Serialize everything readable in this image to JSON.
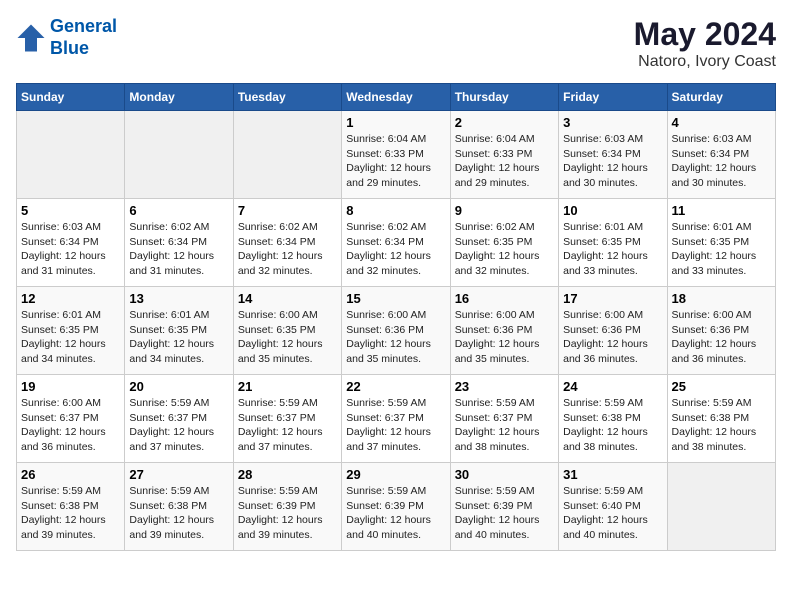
{
  "header": {
    "logo_line1": "General",
    "logo_line2": "Blue",
    "month_year": "May 2024",
    "location": "Natoro, Ivory Coast"
  },
  "weekdays": [
    "Sunday",
    "Monday",
    "Tuesday",
    "Wednesday",
    "Thursday",
    "Friday",
    "Saturday"
  ],
  "weeks": [
    [
      {
        "day": "",
        "info": ""
      },
      {
        "day": "",
        "info": ""
      },
      {
        "day": "",
        "info": ""
      },
      {
        "day": "1",
        "info": "Sunrise: 6:04 AM\nSunset: 6:33 PM\nDaylight: 12 hours\nand 29 minutes."
      },
      {
        "day": "2",
        "info": "Sunrise: 6:04 AM\nSunset: 6:33 PM\nDaylight: 12 hours\nand 29 minutes."
      },
      {
        "day": "3",
        "info": "Sunrise: 6:03 AM\nSunset: 6:34 PM\nDaylight: 12 hours\nand 30 minutes."
      },
      {
        "day": "4",
        "info": "Sunrise: 6:03 AM\nSunset: 6:34 PM\nDaylight: 12 hours\nand 30 minutes."
      }
    ],
    [
      {
        "day": "5",
        "info": "Sunrise: 6:03 AM\nSunset: 6:34 PM\nDaylight: 12 hours\nand 31 minutes."
      },
      {
        "day": "6",
        "info": "Sunrise: 6:02 AM\nSunset: 6:34 PM\nDaylight: 12 hours\nand 31 minutes."
      },
      {
        "day": "7",
        "info": "Sunrise: 6:02 AM\nSunset: 6:34 PM\nDaylight: 12 hours\nand 32 minutes."
      },
      {
        "day": "8",
        "info": "Sunrise: 6:02 AM\nSunset: 6:34 PM\nDaylight: 12 hours\nand 32 minutes."
      },
      {
        "day": "9",
        "info": "Sunrise: 6:02 AM\nSunset: 6:35 PM\nDaylight: 12 hours\nand 32 minutes."
      },
      {
        "day": "10",
        "info": "Sunrise: 6:01 AM\nSunset: 6:35 PM\nDaylight: 12 hours\nand 33 minutes."
      },
      {
        "day": "11",
        "info": "Sunrise: 6:01 AM\nSunset: 6:35 PM\nDaylight: 12 hours\nand 33 minutes."
      }
    ],
    [
      {
        "day": "12",
        "info": "Sunrise: 6:01 AM\nSunset: 6:35 PM\nDaylight: 12 hours\nand 34 minutes."
      },
      {
        "day": "13",
        "info": "Sunrise: 6:01 AM\nSunset: 6:35 PM\nDaylight: 12 hours\nand 34 minutes."
      },
      {
        "day": "14",
        "info": "Sunrise: 6:00 AM\nSunset: 6:35 PM\nDaylight: 12 hours\nand 35 minutes."
      },
      {
        "day": "15",
        "info": "Sunrise: 6:00 AM\nSunset: 6:36 PM\nDaylight: 12 hours\nand 35 minutes."
      },
      {
        "day": "16",
        "info": "Sunrise: 6:00 AM\nSunset: 6:36 PM\nDaylight: 12 hours\nand 35 minutes."
      },
      {
        "day": "17",
        "info": "Sunrise: 6:00 AM\nSunset: 6:36 PM\nDaylight: 12 hours\nand 36 minutes."
      },
      {
        "day": "18",
        "info": "Sunrise: 6:00 AM\nSunset: 6:36 PM\nDaylight: 12 hours\nand 36 minutes."
      }
    ],
    [
      {
        "day": "19",
        "info": "Sunrise: 6:00 AM\nSunset: 6:37 PM\nDaylight: 12 hours\nand 36 minutes."
      },
      {
        "day": "20",
        "info": "Sunrise: 5:59 AM\nSunset: 6:37 PM\nDaylight: 12 hours\nand 37 minutes."
      },
      {
        "day": "21",
        "info": "Sunrise: 5:59 AM\nSunset: 6:37 PM\nDaylight: 12 hours\nand 37 minutes."
      },
      {
        "day": "22",
        "info": "Sunrise: 5:59 AM\nSunset: 6:37 PM\nDaylight: 12 hours\nand 37 minutes."
      },
      {
        "day": "23",
        "info": "Sunrise: 5:59 AM\nSunset: 6:37 PM\nDaylight: 12 hours\nand 38 minutes."
      },
      {
        "day": "24",
        "info": "Sunrise: 5:59 AM\nSunset: 6:38 PM\nDaylight: 12 hours\nand 38 minutes."
      },
      {
        "day": "25",
        "info": "Sunrise: 5:59 AM\nSunset: 6:38 PM\nDaylight: 12 hours\nand 38 minutes."
      }
    ],
    [
      {
        "day": "26",
        "info": "Sunrise: 5:59 AM\nSunset: 6:38 PM\nDaylight: 12 hours\nand 39 minutes."
      },
      {
        "day": "27",
        "info": "Sunrise: 5:59 AM\nSunset: 6:38 PM\nDaylight: 12 hours\nand 39 minutes."
      },
      {
        "day": "28",
        "info": "Sunrise: 5:59 AM\nSunset: 6:39 PM\nDaylight: 12 hours\nand 39 minutes."
      },
      {
        "day": "29",
        "info": "Sunrise: 5:59 AM\nSunset: 6:39 PM\nDaylight: 12 hours\nand 40 minutes."
      },
      {
        "day": "30",
        "info": "Sunrise: 5:59 AM\nSunset: 6:39 PM\nDaylight: 12 hours\nand 40 minutes."
      },
      {
        "day": "31",
        "info": "Sunrise: 5:59 AM\nSunset: 6:40 PM\nDaylight: 12 hours\nand 40 minutes."
      },
      {
        "day": "",
        "info": ""
      }
    ]
  ]
}
